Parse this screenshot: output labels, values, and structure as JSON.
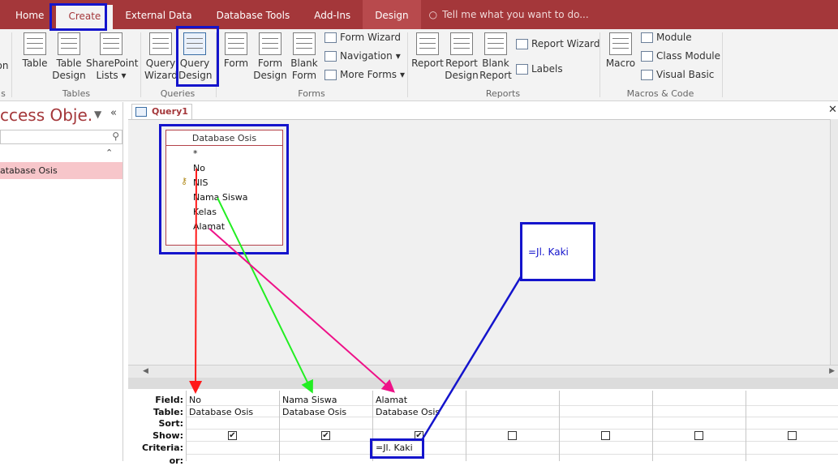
{
  "tabs": [
    "Home",
    "Create",
    "External Data",
    "Database Tools",
    "Add-Ins",
    "Design"
  ],
  "active_tab": "Create",
  "tell_me": "Tell me what you want to do...",
  "ribbon": {
    "tables": {
      "title": "Tables",
      "buttons": [
        "Table",
        "Table Design",
        "SharePoint Lists"
      ]
    },
    "queries": {
      "title": "Queries",
      "buttons": [
        "Query Wizard",
        "Query Design"
      ]
    },
    "forms": {
      "title": "Forms",
      "buttons": [
        "Form",
        "Form Design",
        "Blank Form"
      ],
      "small": [
        "Form Wizard",
        "Navigation",
        "More Forms"
      ]
    },
    "reports": {
      "title": "Reports",
      "buttons": [
        "Report",
        "Report Design",
        "Blank Report"
      ],
      "small": [
        "Report Wizard",
        "Labels"
      ]
    },
    "macros": {
      "title": "Macros & Code",
      "buttons": [
        "Macro"
      ],
      "small": [
        "Module",
        "Class Module",
        "Visual Basic"
      ]
    },
    "left_cut_label": "on",
    "left_cut_group": "s"
  },
  "nav": {
    "title": "ccess Obje...",
    "item": "atabase Osis"
  },
  "doc_tab": "Query1",
  "field_list": {
    "title": "Database Osis",
    "fields": [
      "*",
      "No",
      "NIS",
      "Nama Siswa",
      "Kelas",
      "Alamat"
    ]
  },
  "note_text": "=Jl. Kaki",
  "grid": {
    "row_labels": [
      "Field:",
      "Table:",
      "Sort:",
      "Show:",
      "Criteria:",
      "or:"
    ],
    "columns": [
      {
        "field": "No",
        "table": "Database Osis",
        "show": true,
        "criteria": ""
      },
      {
        "field": "Nama Siswa",
        "table": "Database Osis",
        "show": true,
        "criteria": ""
      },
      {
        "field": "Alamat",
        "table": "Database Osis",
        "show": true,
        "criteria": "=Jl. Kaki"
      },
      {
        "field": "",
        "table": "",
        "show": false,
        "criteria": ""
      },
      {
        "field": "",
        "table": "",
        "show": false,
        "criteria": ""
      },
      {
        "field": "",
        "table": "",
        "show": false,
        "criteria": ""
      },
      {
        "field": "",
        "table": "",
        "show": false,
        "criteria": ""
      }
    ]
  },
  "colors": {
    "accent": "#a4373a",
    "annotation_blue": "#1414cc",
    "arrow_red": "#ff1a1a",
    "arrow_green": "#22ee22",
    "arrow_pink": "#ee1188"
  }
}
